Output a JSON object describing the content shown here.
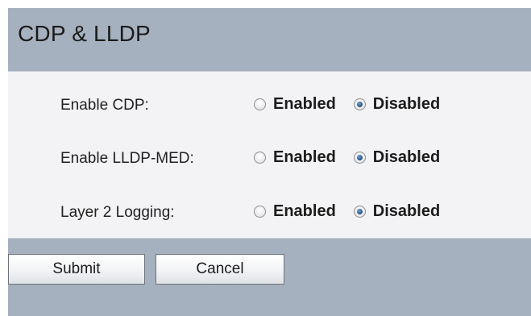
{
  "page": {
    "title": "CDP & LLDP"
  },
  "settings": [
    {
      "label": "Enable CDP:",
      "enabled_label": "Enabled",
      "disabled_label": "Disabled",
      "selected": "Disabled"
    },
    {
      "label": "Enable LLDP-MED:",
      "enabled_label": "Enabled",
      "disabled_label": "Disabled",
      "selected": "Disabled"
    },
    {
      "label": "Layer 2 Logging:",
      "enabled_label": "Enabled",
      "disabled_label": "Disabled",
      "selected": "Disabled"
    }
  ],
  "buttons": {
    "submit": "Submit",
    "cancel": "Cancel"
  },
  "colors": {
    "panel_background": "#a6b1bf",
    "settings_background": "#f3f3f5",
    "radio_selected": "#22507f"
  }
}
